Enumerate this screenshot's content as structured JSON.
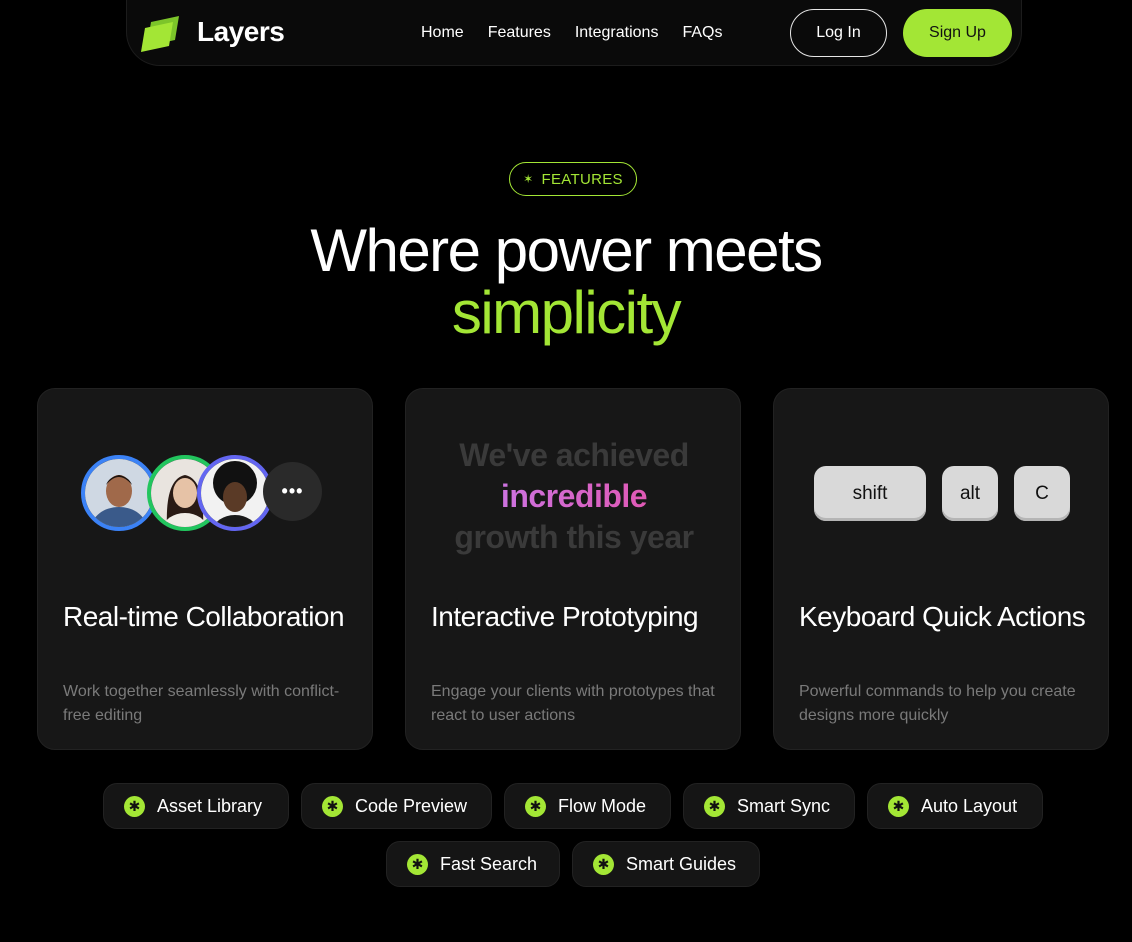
{
  "nav": {
    "brand": "Layers",
    "links": [
      "Home",
      "Features",
      "Integrations",
      "FAQs"
    ],
    "login_label": "Log In",
    "signup_label": "Sign Up"
  },
  "badge": {
    "label": "FEATURES",
    "icon": "star-icon"
  },
  "headline": {
    "line1": "Where power meets",
    "accent": "simplicity"
  },
  "cards": [
    {
      "title": "Real-time Collaboration",
      "description": "Work together seamlessly with conflict-free editing",
      "more_label": "•••"
    },
    {
      "title": "Interactive Prototyping",
      "description": "Engage your clients with prototypes that react to user actions",
      "preview": {
        "top": "We've achieved",
        "highlight": "incredible",
        "bottom": "growth this year"
      }
    },
    {
      "title": "Keyboard Quick Actions",
      "description": "Powerful commands to help you create designs more quickly",
      "keys": [
        "shift",
        "alt",
        "C"
      ]
    }
  ],
  "chips": [
    "Asset Library",
    "Code Preview",
    "Flow Mode",
    "Smart Sync",
    "Auto Layout",
    "Fast Search",
    "Smart Guides"
  ],
  "colors": {
    "accent": "#a3e635",
    "background": "#000000",
    "card": "#171717"
  }
}
